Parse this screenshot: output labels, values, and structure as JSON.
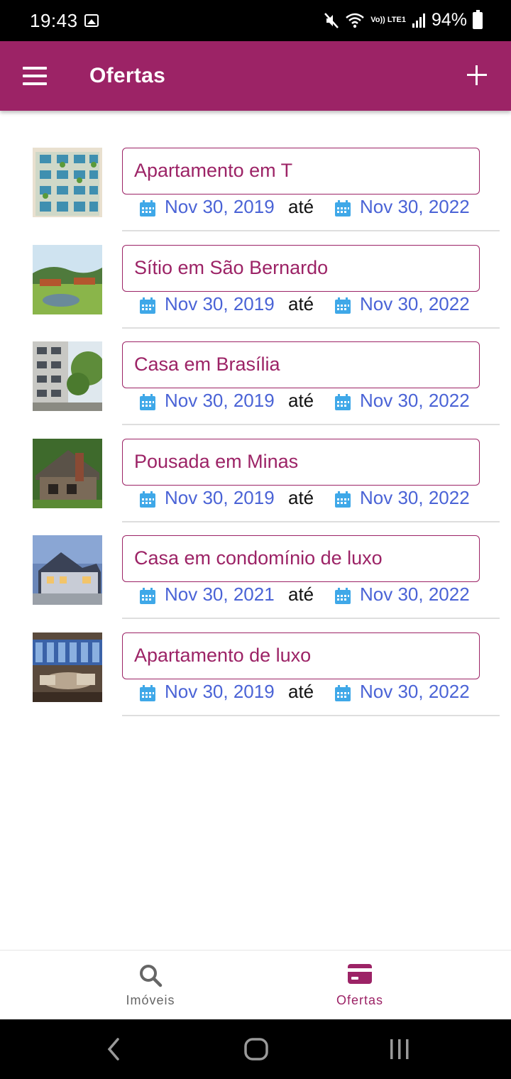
{
  "status_bar": {
    "time": "19:43",
    "battery": "94%",
    "network_label": "Vo)) LTE1"
  },
  "app_bar": {
    "title": "Ofertas",
    "menu_icon": "hamburger-menu-icon",
    "add_icon": "plus-icon"
  },
  "offers": [
    {
      "title": "Apartamento em T",
      "start_date": "Nov 30, 2019",
      "separator": "até",
      "end_date": "Nov 30, 2022",
      "thumb": "apartment-facade"
    },
    {
      "title": "Sítio em São Bernardo",
      "start_date": "Nov 30, 2019",
      "separator": "até",
      "end_date": "Nov 30, 2022",
      "thumb": "countryside-farm"
    },
    {
      "title": "Casa em Brasília",
      "start_date": "Nov 30, 2019",
      "separator": "até",
      "end_date": "Nov 30, 2022",
      "thumb": "building-trees"
    },
    {
      "title": "Pousada em Minas",
      "start_date": "Nov 30, 2019",
      "separator": "até",
      "end_date": "Nov 30, 2022",
      "thumb": "log-cabin"
    },
    {
      "title": "Casa em condomínio de luxo",
      "start_date": "Nov 30, 2021",
      "separator": "até",
      "end_date": "Nov 30, 2022",
      "thumb": "luxury-house"
    },
    {
      "title": "Apartamento de luxo",
      "start_date": "Nov 30, 2019",
      "separator": "até",
      "end_date": "Nov 30, 2022",
      "thumb": "luxury-lounge"
    }
  ],
  "bottom_nav": {
    "items": [
      {
        "label": "Imóveis",
        "icon": "search-icon",
        "active": false
      },
      {
        "label": "Ofertas",
        "icon": "card-icon",
        "active": true
      }
    ]
  },
  "colors": {
    "primary": "#9c2366",
    "date_text": "#4a63d6",
    "calendar_icon": "#3fa8e8",
    "inactive_nav": "#666666"
  }
}
